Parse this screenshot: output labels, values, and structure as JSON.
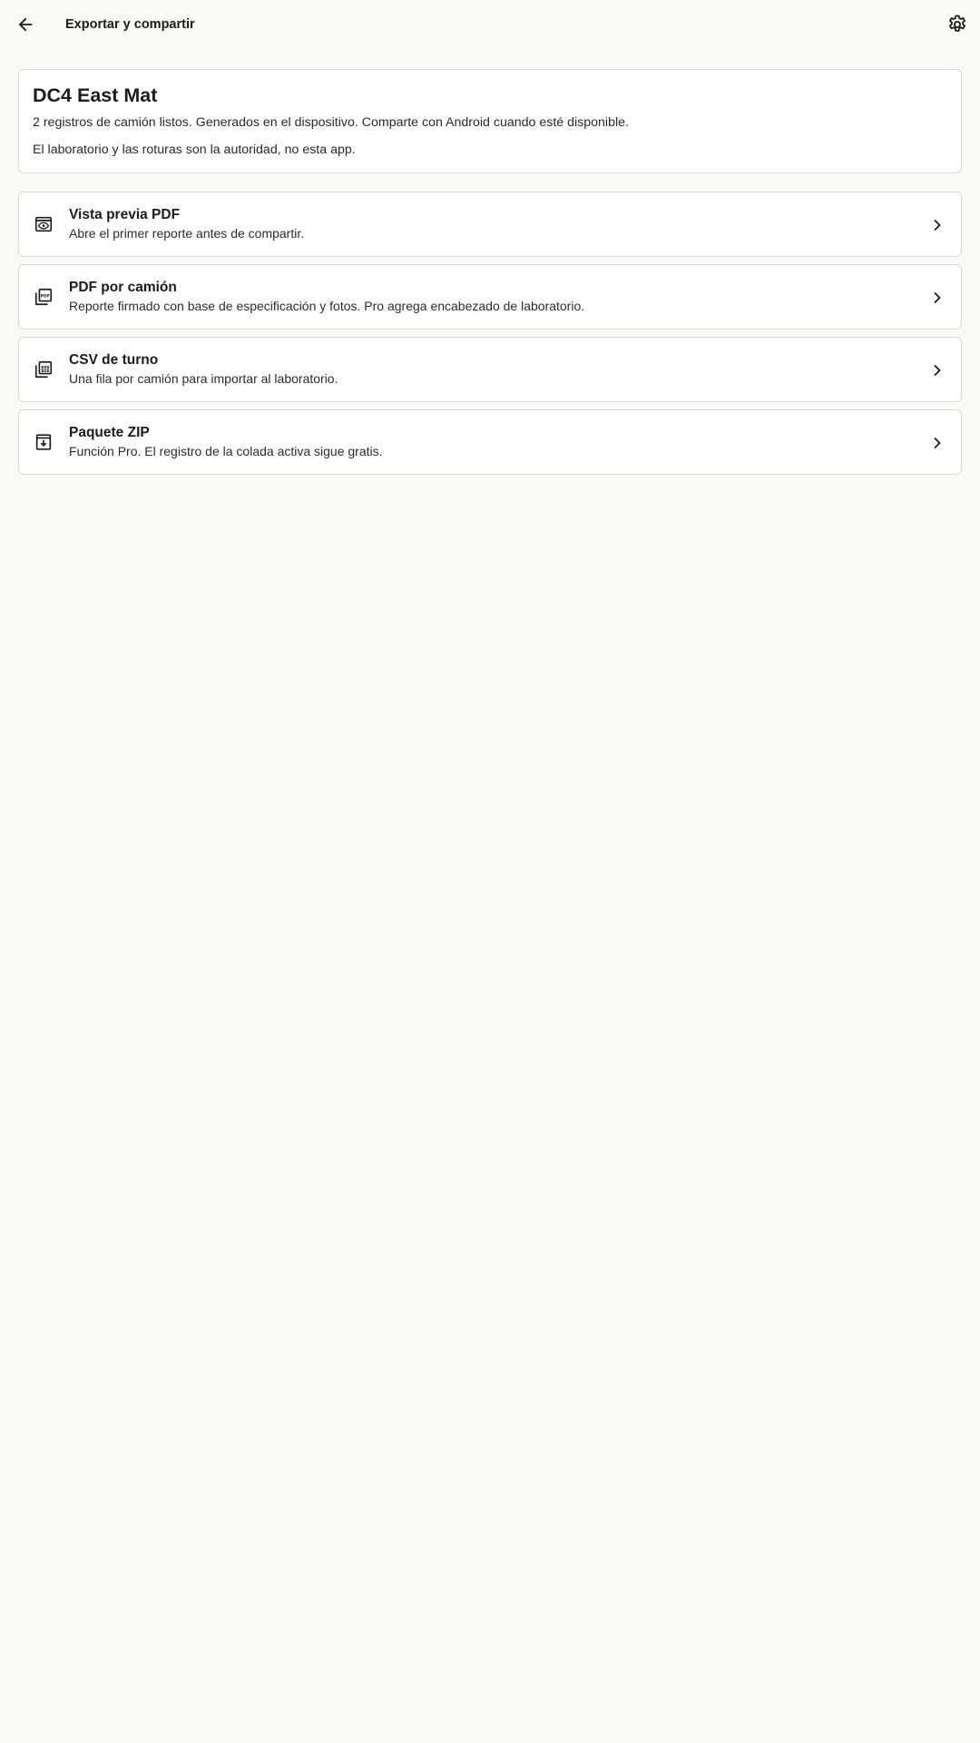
{
  "topbar": {
    "title": "Exportar y compartir",
    "back_icon": "arrow-back-icon",
    "settings_icon": "gear-icon"
  },
  "summary": {
    "project_name": "DC4 East Mat",
    "status_line": "2 registros de camión listos. Generados en el dispositivo. Comparte con Android cuando esté disponible.",
    "disclaimer": "El laboratorio y las roturas son la autoridad, no esta app."
  },
  "actions": [
    {
      "icon": "eye-preview-icon",
      "title": "Vista previa PDF",
      "subtitle": "Abre el primer reporte antes de compartir."
    },
    {
      "icon": "pdf-stack-icon",
      "title": "PDF por camión",
      "subtitle": "Reporte firmado con base de especificación y fotos. Pro agrega encabezado de laboratorio."
    },
    {
      "icon": "table-stack-icon",
      "title": "CSV de turno",
      "subtitle": "Una fila por camión para importar al laboratorio."
    },
    {
      "icon": "archive-download-icon",
      "title": "Paquete ZIP",
      "subtitle": "Función Pro. El registro de la colada activa sigue gratis."
    }
  ],
  "colors": {
    "background": "#f9f9f6",
    "card": "#ffffff",
    "border": "#d9d9d6",
    "text": "#1c1c1c"
  }
}
